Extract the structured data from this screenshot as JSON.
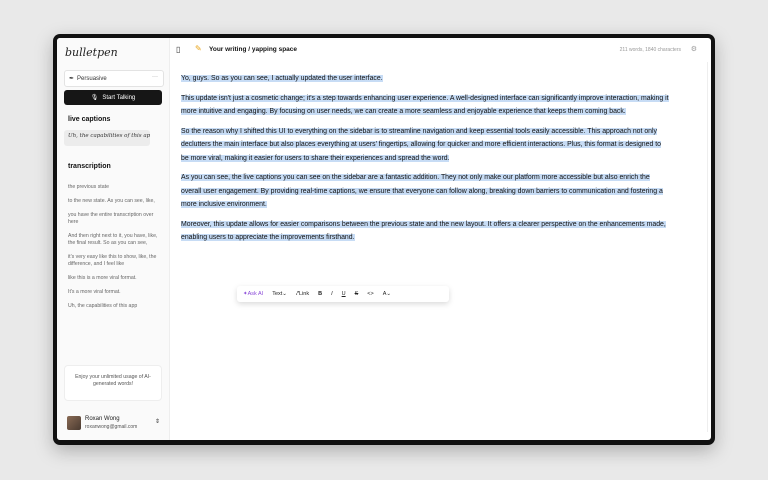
{
  "app": {
    "logo": "bulletpen"
  },
  "sidebar": {
    "mode": {
      "icon": "quill-icon",
      "label": "Persuasive"
    },
    "start_button": {
      "icon": "mic-off-icon",
      "label": "Start Talking"
    },
    "live_captions": {
      "heading": "live captions",
      "text": "Uh, the capabilities of this app"
    },
    "transcription": {
      "heading": "transcription",
      "items": [
        "the previous state",
        "to the new state. As you can see, like,",
        "you have the entire transcription over here",
        "And then right next to it, you have, like, the final result. So as you can see,",
        "it's very easy like this to show, like, the difference, and I feel like",
        "like this is a more viral format.",
        "It's a more viral format.",
        "Uh, the capabilities of this app"
      ]
    },
    "promo": "Enjoy your unlimited usage of AI-generated words!",
    "user": {
      "name": "Roxan Wong",
      "email": "roxanwong@gmail.com"
    }
  },
  "header": {
    "title": "Your writing / yapping space",
    "stats": "211 words, 1840 characters"
  },
  "document": {
    "paragraphs": [
      "Yo, guys. So as you can see, I actually updated the user interface.",
      "This update isn't just a cosmetic change; it's a step towards enhancing user experience. A well-designed interface can significantly improve interaction, making it more intuitive and engaging. By focusing on user needs, we can create a more seamless and enjoyable experience that keeps them coming back.",
      "So the reason why I shifted this UI to everything on the sidebar is to streamline navigation and keep essential tools easily accessible. This approach not only declutters the main interface but also places everything at users' fingertips, allowing for quicker and more efficient interactions. Plus, this format is designed to be more viral, making it easier for users to share their experiences and spread the word.",
      "As you can see, the live captions you can see on the sidebar are a fantastic addition. They not only make our platform more accessible but also enrich the overall user engagement. By providing real-time captions, we ensure that everyone can follow along, breaking down barriers to communication and fostering a more inclusive environment.",
      "Moreover, this update allows for easier comparisons between the previous state and the new layout. It offers a clearer perspective on the enhancements made, enabling users to appreciate the improvements firsthand."
    ]
  },
  "toolbar": {
    "ask_ai": "Ask AI",
    "text": "Text",
    "link": "Link",
    "bold": "B",
    "italic": "I",
    "underline": "U",
    "strike": "S",
    "code": "<>",
    "color": "A"
  },
  "colors": {
    "selection": "#c7dcf5",
    "ask_ai": "#8b4bd8",
    "primary_button": "#161616"
  }
}
